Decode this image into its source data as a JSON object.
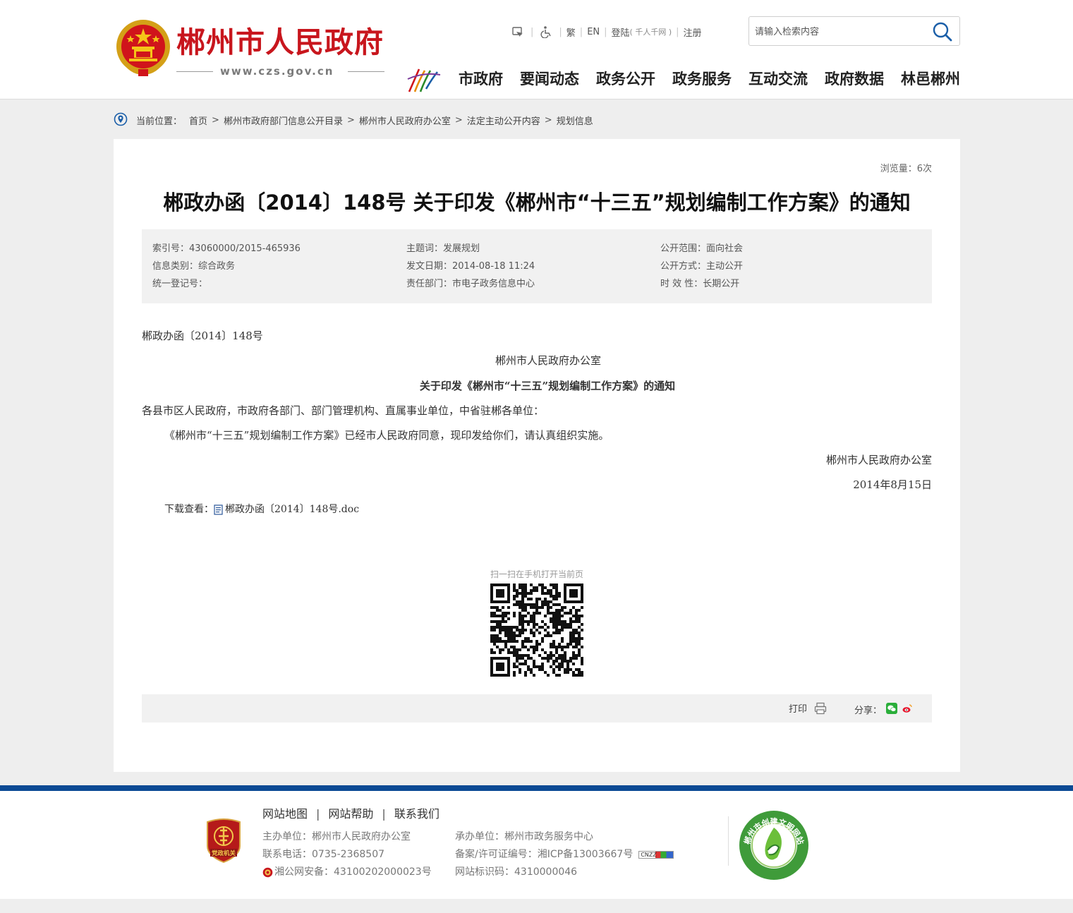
{
  "header": {
    "site_title": "郴州市人民政府",
    "site_url": "www.czs.gov.cn",
    "topbar": {
      "traditional": "繁",
      "english": "EN",
      "login": "登陆",
      "login_note": "( 千人千网 )",
      "register": "注册"
    },
    "search": {
      "placeholder": "请输入检索内容"
    },
    "nav": [
      "市政府",
      "要闻动态",
      "政务公开",
      "政务服务",
      "互动交流",
      "政府数据",
      "林邑郴州"
    ]
  },
  "breadcrumb": {
    "label": "当前位置：",
    "items": [
      "首页",
      "郴州市政府部门信息公开目录",
      "郴州市人民政府办公室",
      "法定主动公开内容",
      "规划信息"
    ],
    "sep": ">"
  },
  "article": {
    "views": "浏览量：6次",
    "title": "郴政办函〔2014〕148号 关于印发《郴州市“十三五”规划编制工作方案》的通知",
    "meta": {
      "index_no": "索引号：43060000/2015-465936",
      "category": "信息类别：综合政务",
      "reg_no": "统一登记号：",
      "subject": "主题词：发展规划",
      "date": "发文日期：2014-08-18 11:24",
      "dept": "责任部门：市电子政务信息中心",
      "scope": "公开范围：面向社会",
      "method": "公开方式：主动公开",
      "validity": "时 效 性：长期公开"
    },
    "doc_no": "郴政办函〔2014〕148号",
    "issuer": "郴州市人民政府办公室",
    "subtitle": "关于印发《郴州市“十三五”规划编制工作方案》的通知",
    "recipients": "各县市区人民政府，市政府各部门、部门管理机构、直属事业单位，中省驻郴各单位：",
    "body": "《郴州市“十三五”规划编制工作方案》已经市人民政府同意，现印发给你们，请认真组织实施。",
    "sign_org": "郴州市人民政府办公室",
    "sign_date": "2014年8月15日",
    "download_label": "下载查看：",
    "download_file": "郴政办函〔2014〕148号.doc",
    "qr_caption": "扫一扫在手机打开当前页",
    "print": "打印",
    "share": "分享："
  },
  "footer": {
    "links": [
      "网站地图",
      "网站帮助",
      "联系我们"
    ],
    "host": "主办单位：郴州市人民政府办公室",
    "phone": "联系电话：0735-2368507",
    "police": "湘公网安备：43100202000023号",
    "undertaker": "承办单位：郴州市政务服务中心",
    "icp": "备案/许可证编号：湘ICP备13003667号",
    "site_id": "网站标识码：4310000046",
    "cnzz": "CNZZ",
    "badge_left": "党政机关",
    "badge_right": "郴州市创建文明网站"
  },
  "colors": {
    "brand_red": "#c8161d",
    "footer_blue": "#0b4a94",
    "meta_bg": "#f1f1f1",
    "page_bg": "#eeeeee"
  },
  "icons": [
    "emblem-icon",
    "accessibility-icon",
    "wheelchair-icon",
    "search-icon",
    "location-pin-icon",
    "doc-file-icon",
    "qr-code-icon",
    "printer-icon",
    "wechat-icon",
    "weibo-icon",
    "police-badge-icon"
  ]
}
